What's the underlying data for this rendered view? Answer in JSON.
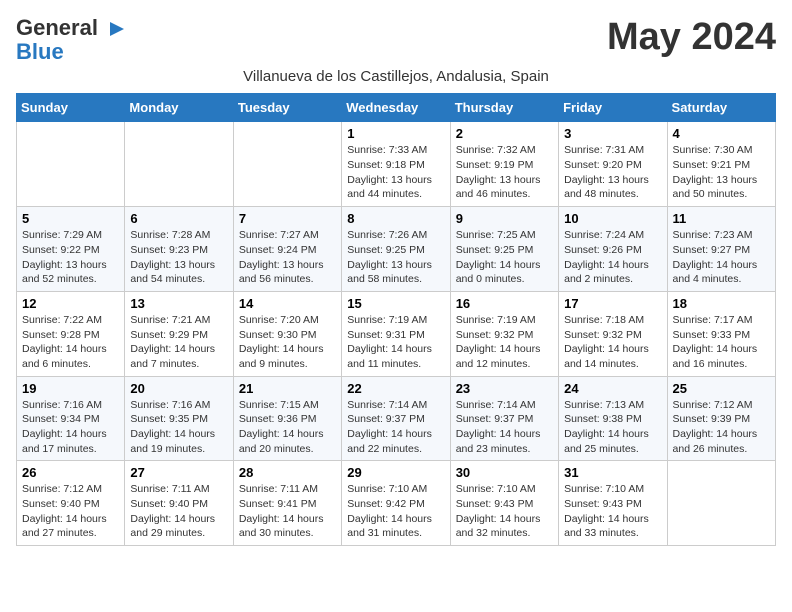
{
  "logo": {
    "line1": "General",
    "line2": "Blue"
  },
  "title": "May 2024",
  "subtitle": "Villanueva de los Castillejos, Andalusia, Spain",
  "days_of_week": [
    "Sunday",
    "Monday",
    "Tuesday",
    "Wednesday",
    "Thursday",
    "Friday",
    "Saturday"
  ],
  "weeks": [
    [
      {
        "day": "",
        "sunrise": "",
        "sunset": "",
        "daylight": ""
      },
      {
        "day": "",
        "sunrise": "",
        "sunset": "",
        "daylight": ""
      },
      {
        "day": "",
        "sunrise": "",
        "sunset": "",
        "daylight": ""
      },
      {
        "day": "1",
        "sunrise": "Sunrise: 7:33 AM",
        "sunset": "Sunset: 9:18 PM",
        "daylight": "Daylight: 13 hours and 44 minutes."
      },
      {
        "day": "2",
        "sunrise": "Sunrise: 7:32 AM",
        "sunset": "Sunset: 9:19 PM",
        "daylight": "Daylight: 13 hours and 46 minutes."
      },
      {
        "day": "3",
        "sunrise": "Sunrise: 7:31 AM",
        "sunset": "Sunset: 9:20 PM",
        "daylight": "Daylight: 13 hours and 48 minutes."
      },
      {
        "day": "4",
        "sunrise": "Sunrise: 7:30 AM",
        "sunset": "Sunset: 9:21 PM",
        "daylight": "Daylight: 13 hours and 50 minutes."
      }
    ],
    [
      {
        "day": "5",
        "sunrise": "Sunrise: 7:29 AM",
        "sunset": "Sunset: 9:22 PM",
        "daylight": "Daylight: 13 hours and 52 minutes."
      },
      {
        "day": "6",
        "sunrise": "Sunrise: 7:28 AM",
        "sunset": "Sunset: 9:23 PM",
        "daylight": "Daylight: 13 hours and 54 minutes."
      },
      {
        "day": "7",
        "sunrise": "Sunrise: 7:27 AM",
        "sunset": "Sunset: 9:24 PM",
        "daylight": "Daylight: 13 hours and 56 minutes."
      },
      {
        "day": "8",
        "sunrise": "Sunrise: 7:26 AM",
        "sunset": "Sunset: 9:25 PM",
        "daylight": "Daylight: 13 hours and 58 minutes."
      },
      {
        "day": "9",
        "sunrise": "Sunrise: 7:25 AM",
        "sunset": "Sunset: 9:25 PM",
        "daylight": "Daylight: 14 hours and 0 minutes."
      },
      {
        "day": "10",
        "sunrise": "Sunrise: 7:24 AM",
        "sunset": "Sunset: 9:26 PM",
        "daylight": "Daylight: 14 hours and 2 minutes."
      },
      {
        "day": "11",
        "sunrise": "Sunrise: 7:23 AM",
        "sunset": "Sunset: 9:27 PM",
        "daylight": "Daylight: 14 hours and 4 minutes."
      }
    ],
    [
      {
        "day": "12",
        "sunrise": "Sunrise: 7:22 AM",
        "sunset": "Sunset: 9:28 PM",
        "daylight": "Daylight: 14 hours and 6 minutes."
      },
      {
        "day": "13",
        "sunrise": "Sunrise: 7:21 AM",
        "sunset": "Sunset: 9:29 PM",
        "daylight": "Daylight: 14 hours and 7 minutes."
      },
      {
        "day": "14",
        "sunrise": "Sunrise: 7:20 AM",
        "sunset": "Sunset: 9:30 PM",
        "daylight": "Daylight: 14 hours and 9 minutes."
      },
      {
        "day": "15",
        "sunrise": "Sunrise: 7:19 AM",
        "sunset": "Sunset: 9:31 PM",
        "daylight": "Daylight: 14 hours and 11 minutes."
      },
      {
        "day": "16",
        "sunrise": "Sunrise: 7:19 AM",
        "sunset": "Sunset: 9:32 PM",
        "daylight": "Daylight: 14 hours and 12 minutes."
      },
      {
        "day": "17",
        "sunrise": "Sunrise: 7:18 AM",
        "sunset": "Sunset: 9:32 PM",
        "daylight": "Daylight: 14 hours and 14 minutes."
      },
      {
        "day": "18",
        "sunrise": "Sunrise: 7:17 AM",
        "sunset": "Sunset: 9:33 PM",
        "daylight": "Daylight: 14 hours and 16 minutes."
      }
    ],
    [
      {
        "day": "19",
        "sunrise": "Sunrise: 7:16 AM",
        "sunset": "Sunset: 9:34 PM",
        "daylight": "Daylight: 14 hours and 17 minutes."
      },
      {
        "day": "20",
        "sunrise": "Sunrise: 7:16 AM",
        "sunset": "Sunset: 9:35 PM",
        "daylight": "Daylight: 14 hours and 19 minutes."
      },
      {
        "day": "21",
        "sunrise": "Sunrise: 7:15 AM",
        "sunset": "Sunset: 9:36 PM",
        "daylight": "Daylight: 14 hours and 20 minutes."
      },
      {
        "day": "22",
        "sunrise": "Sunrise: 7:14 AM",
        "sunset": "Sunset: 9:37 PM",
        "daylight": "Daylight: 14 hours and 22 minutes."
      },
      {
        "day": "23",
        "sunrise": "Sunrise: 7:14 AM",
        "sunset": "Sunset: 9:37 PM",
        "daylight": "Daylight: 14 hours and 23 minutes."
      },
      {
        "day": "24",
        "sunrise": "Sunrise: 7:13 AM",
        "sunset": "Sunset: 9:38 PM",
        "daylight": "Daylight: 14 hours and 25 minutes."
      },
      {
        "day": "25",
        "sunrise": "Sunrise: 7:12 AM",
        "sunset": "Sunset: 9:39 PM",
        "daylight": "Daylight: 14 hours and 26 minutes."
      }
    ],
    [
      {
        "day": "26",
        "sunrise": "Sunrise: 7:12 AM",
        "sunset": "Sunset: 9:40 PM",
        "daylight": "Daylight: 14 hours and 27 minutes."
      },
      {
        "day": "27",
        "sunrise": "Sunrise: 7:11 AM",
        "sunset": "Sunset: 9:40 PM",
        "daylight": "Daylight: 14 hours and 29 minutes."
      },
      {
        "day": "28",
        "sunrise": "Sunrise: 7:11 AM",
        "sunset": "Sunset: 9:41 PM",
        "daylight": "Daylight: 14 hours and 30 minutes."
      },
      {
        "day": "29",
        "sunrise": "Sunrise: 7:10 AM",
        "sunset": "Sunset: 9:42 PM",
        "daylight": "Daylight: 14 hours and 31 minutes."
      },
      {
        "day": "30",
        "sunrise": "Sunrise: 7:10 AM",
        "sunset": "Sunset: 9:43 PM",
        "daylight": "Daylight: 14 hours and 32 minutes."
      },
      {
        "day": "31",
        "sunrise": "Sunrise: 7:10 AM",
        "sunset": "Sunset: 9:43 PM",
        "daylight": "Daylight: 14 hours and 33 minutes."
      },
      {
        "day": "",
        "sunrise": "",
        "sunset": "",
        "daylight": ""
      }
    ]
  ]
}
